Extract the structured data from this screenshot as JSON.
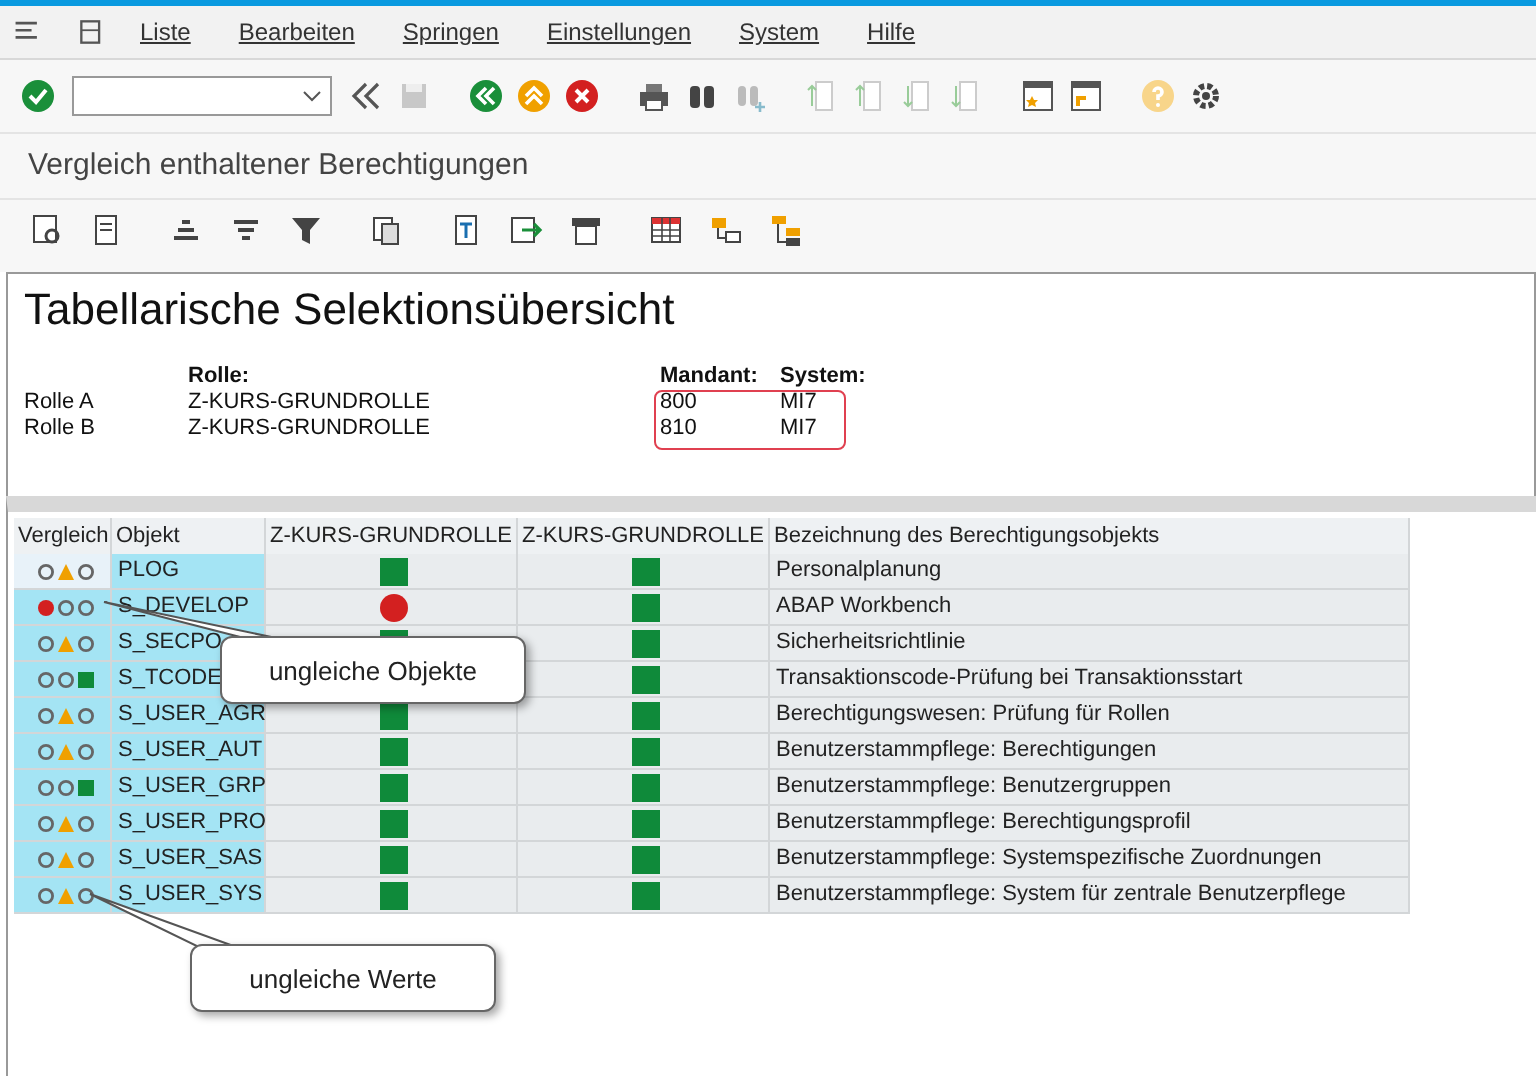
{
  "menu": [
    "Liste",
    "Bearbeiten",
    "Springen",
    "Einstellungen",
    "System",
    "Hilfe"
  ],
  "screen_title": "Vergleich enthaltener Berechtigungen",
  "header": {
    "title": "Tabellarische Selektionsübersicht",
    "col_role": "Rolle:",
    "col_client": "Mandant:",
    "col_system": "System:",
    "rows": [
      {
        "label": "Rolle A",
        "role": "Z-KURS-GRUNDROLLE",
        "client": "800",
        "system": "MI7"
      },
      {
        "label": "Rolle B",
        "role": "Z-KURS-GRUNDROLLE",
        "client": "810",
        "system": "MI7"
      }
    ]
  },
  "table": {
    "columns": [
      "Vergleich",
      "Objekt",
      "Z-KURS-GRUNDROLLE",
      "Z-KURS-GRUNDROLLE",
      "Bezeichnung des Berechtigungsobjekts"
    ],
    "rows": [
      {
        "objects_equal": true,
        "values_equal": false,
        "selected": true,
        "object": "PLOG",
        "in_role_a": true,
        "in_role_b": true,
        "description": "Personalplanung"
      },
      {
        "objects_equal": false,
        "selected": false,
        "object": "S_DEVELOP",
        "in_role_a": false,
        "in_role_b": true,
        "description": "ABAP Workbench"
      },
      {
        "objects_equal": true,
        "values_equal": false,
        "selected": false,
        "object": "S_SECPO",
        "in_role_a": true,
        "in_role_b": true,
        "description": "Sicherheitsrichtlinie"
      },
      {
        "objects_equal": true,
        "values_equal": true,
        "selected": false,
        "object": "S_TCODE",
        "in_role_b": true,
        "description": "Transaktionscode-Prüfung bei Transaktionsstart"
      },
      {
        "objects_equal": true,
        "values_equal": false,
        "selected": false,
        "object": "S_USER_AGR",
        "in_role_a": true,
        "in_role_b": true,
        "description": "Berechtigungswesen: Prüfung für Rollen"
      },
      {
        "objects_equal": true,
        "values_equal": false,
        "selected": false,
        "object": "S_USER_AUT",
        "in_role_a": true,
        "in_role_b": true,
        "description": "Benutzerstammpflege: Berechtigungen"
      },
      {
        "objects_equal": true,
        "values_equal": true,
        "selected": false,
        "object": "S_USER_GRP",
        "in_role_a": true,
        "in_role_b": true,
        "description": "Benutzerstammpflege: Benutzergruppen"
      },
      {
        "objects_equal": true,
        "values_equal": false,
        "selected": false,
        "object": "S_USER_PRO",
        "in_role_a": true,
        "in_role_b": true,
        "description": "Benutzerstammpflege: Berechtigungsprofil"
      },
      {
        "objects_equal": true,
        "values_equal": false,
        "selected": false,
        "object": "S_USER_SAS",
        "in_role_a": true,
        "in_role_b": true,
        "description": "Benutzerstammpflege: Systemspezifische Zuordnungen"
      },
      {
        "objects_equal": true,
        "values_equal": false,
        "selected": false,
        "object": "S_USER_SYS",
        "in_role_a": true,
        "in_role_b": true,
        "description": "Benutzerstammpflege: System für zentrale Benutzerpflege"
      }
    ]
  },
  "callouts": [
    {
      "text": "ungleiche Objekte"
    },
    {
      "text": "ungleiche Werte"
    }
  ]
}
